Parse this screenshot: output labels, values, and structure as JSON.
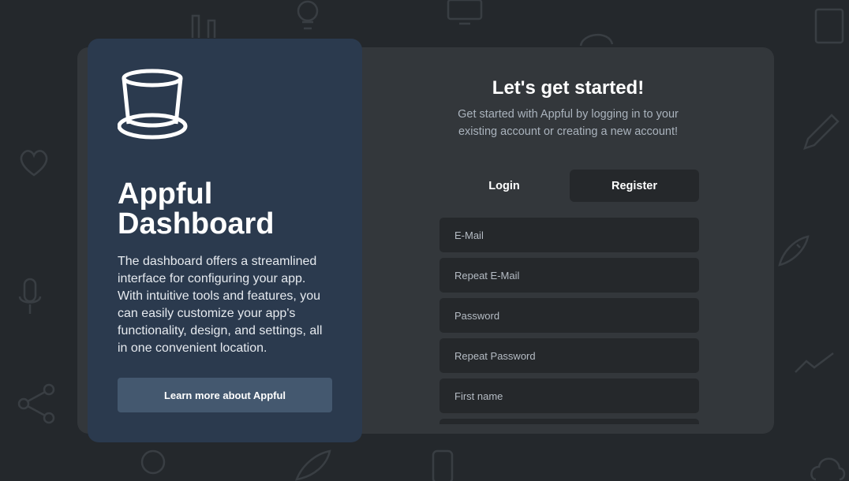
{
  "colors": {
    "page_background": "#24282c",
    "back_panel": "#33373b",
    "left_card": "#2b3a4e",
    "learn_button": "#44586f",
    "input_background": "#25282b",
    "active_tab": "#25282b",
    "subtitle_text": "#aab3bd"
  },
  "left_card": {
    "logo_icon": "top-hat-icon",
    "title_line1": "Appful",
    "title_line2": "Dashboard",
    "description": "The dashboard offers a streamlined interface for configuring your app. With intuitive tools and features, you can easily customize your app's functionality, design, and settings, all in one convenient location.",
    "learn_more_label": "Learn more about Appful"
  },
  "form": {
    "title": "Let's get started!",
    "subtitle": "Get started with Appful by logging in to your existing account or creating a new account!",
    "tabs": {
      "login_label": "Login",
      "register_label": "Register",
      "active": "Register"
    },
    "fields": {
      "email_placeholder": "E-Mail",
      "repeat_email_placeholder": "Repeat E-Mail",
      "password_placeholder": "Password",
      "repeat_password_placeholder": "Repeat Password",
      "first_name_placeholder": "First name"
    }
  }
}
